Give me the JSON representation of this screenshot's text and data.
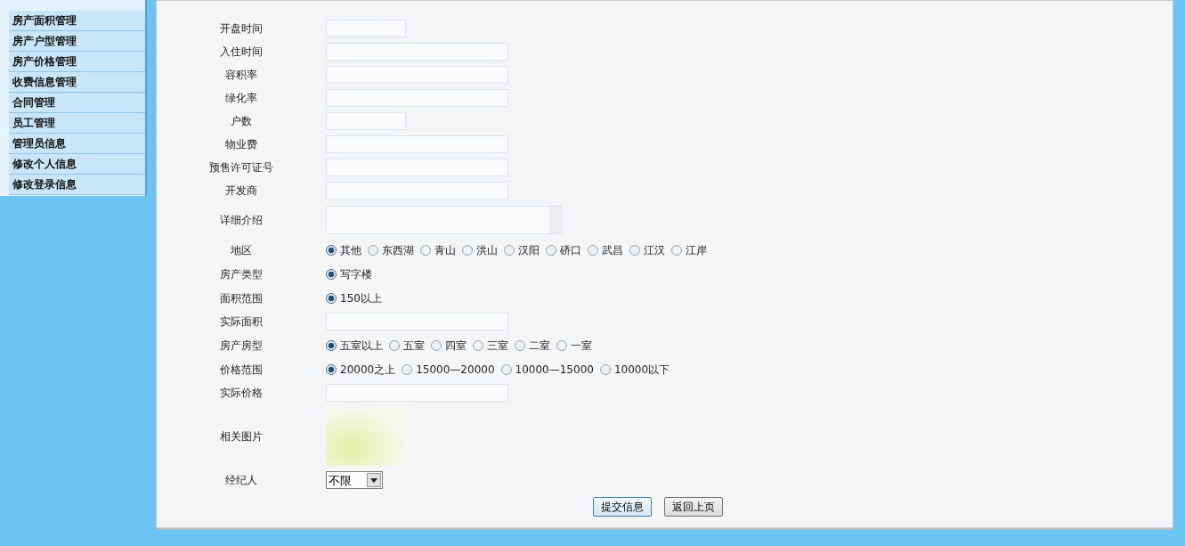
{
  "sidebar": {
    "items": [
      {
        "label": "房产面积管理"
      },
      {
        "label": "房产户型管理"
      },
      {
        "label": "房产价格管理"
      },
      {
        "label": "收费信息管理"
      },
      {
        "label": "合同管理"
      },
      {
        "label": "员工管理"
      },
      {
        "label": "管理员信息"
      },
      {
        "label": "修改个人信息"
      },
      {
        "label": "修改登录信息"
      }
    ]
  },
  "form": {
    "rows": [
      {
        "kind": "short_text",
        "label": "开盘时间"
      },
      {
        "kind": "text",
        "label": "入住时间"
      },
      {
        "kind": "text",
        "label": "容积率"
      },
      {
        "kind": "text",
        "label": "绿化率"
      },
      {
        "kind": "short_text",
        "label": "户数"
      },
      {
        "kind": "text",
        "label": "物业费"
      },
      {
        "kind": "text",
        "label": "预售许可证号"
      },
      {
        "kind": "text",
        "label": "开发商"
      },
      {
        "kind": "textarea",
        "label": "详细介绍"
      },
      {
        "kind": "radio",
        "label": "地区",
        "options": [
          {
            "label": "其他",
            "selected": true
          },
          {
            "label": "东西湖",
            "selected": false
          },
          {
            "label": "青山",
            "selected": false
          },
          {
            "label": "洪山",
            "selected": false
          },
          {
            "label": "汉阳",
            "selected": false
          },
          {
            "label": "硚口",
            "selected": false
          },
          {
            "label": "武昌",
            "selected": false
          },
          {
            "label": "江汉",
            "selected": false
          },
          {
            "label": "江岸",
            "selected": false
          }
        ]
      },
      {
        "kind": "radio",
        "label": "房产类型",
        "options": [
          {
            "label": "写字楼",
            "selected": true
          }
        ]
      },
      {
        "kind": "radio",
        "label": "面积范围",
        "options": [
          {
            "label": "150以上",
            "selected": true
          }
        ]
      },
      {
        "kind": "text",
        "label": "实际面积"
      },
      {
        "kind": "radio",
        "label": "房产房型",
        "options": [
          {
            "label": "五室以上",
            "selected": true
          },
          {
            "label": "五室",
            "selected": false
          },
          {
            "label": "四室",
            "selected": false
          },
          {
            "label": "三室",
            "selected": false
          },
          {
            "label": "二室",
            "selected": false
          },
          {
            "label": "一室",
            "selected": false
          }
        ]
      },
      {
        "kind": "radio",
        "label": "价格范围",
        "options": [
          {
            "label": "20000之上",
            "selected": true
          },
          {
            "label": "15000—20000",
            "selected": false
          },
          {
            "label": "10000—15000",
            "selected": false
          },
          {
            "label": "10000以下",
            "selected": false
          }
        ]
      },
      {
        "kind": "text",
        "label": "实际价格"
      },
      {
        "kind": "image",
        "label": "相关图片"
      },
      {
        "kind": "select",
        "label": "经纪人",
        "value": "不限"
      }
    ],
    "buttons": [
      "提交信息",
      "返回上页"
    ]
  }
}
